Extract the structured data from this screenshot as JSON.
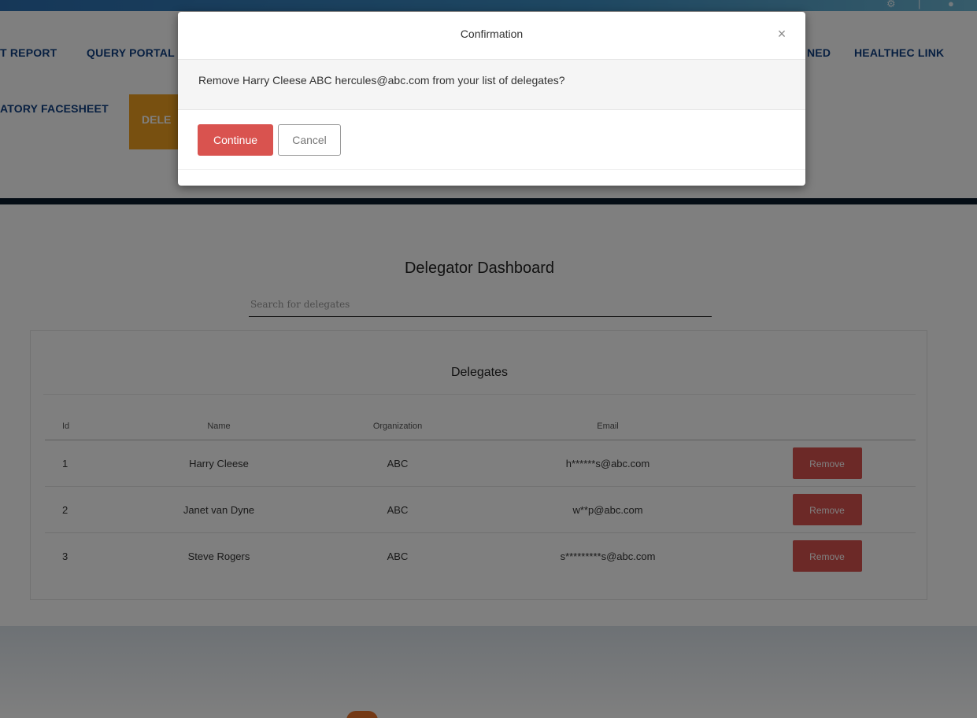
{
  "nav": {
    "items_row1": [
      "T REPORT",
      "QUERY PORTAL",
      "NED",
      "HEALTHEC LINK"
    ],
    "items_row2": [
      "ATORY FACESHEET"
    ],
    "active_item": "DELE"
  },
  "page": {
    "title": "Delegator Dashboard",
    "search_placeholder": "Search for delegates"
  },
  "table": {
    "title": "Delegates",
    "columns": [
      "Id",
      "Name",
      "Organization",
      "Email"
    ],
    "rows": [
      {
        "id": "1",
        "name": "Harry Cleese",
        "organization": "ABC",
        "email": "h******s@abc.com",
        "action": "Remove"
      },
      {
        "id": "2",
        "name": "Janet van Dyne",
        "organization": "ABC",
        "email": "w**p@abc.com",
        "action": "Remove"
      },
      {
        "id": "3",
        "name": "Steve Rogers",
        "organization": "ABC",
        "email": "s*********s@abc.com",
        "action": "Remove"
      }
    ]
  },
  "modal": {
    "title": "Confirmation",
    "close_glyph": "×",
    "message": "Remove Harry Cleese ABC hercules@abc.com from your list of delegates?",
    "continue_label": "Continue",
    "cancel_label": "Cancel"
  },
  "colors": {
    "nav_text": "#0f3f82",
    "active_tab": "#f0a020",
    "danger": "#d9534f",
    "header_strip": "#2c6fb1"
  }
}
